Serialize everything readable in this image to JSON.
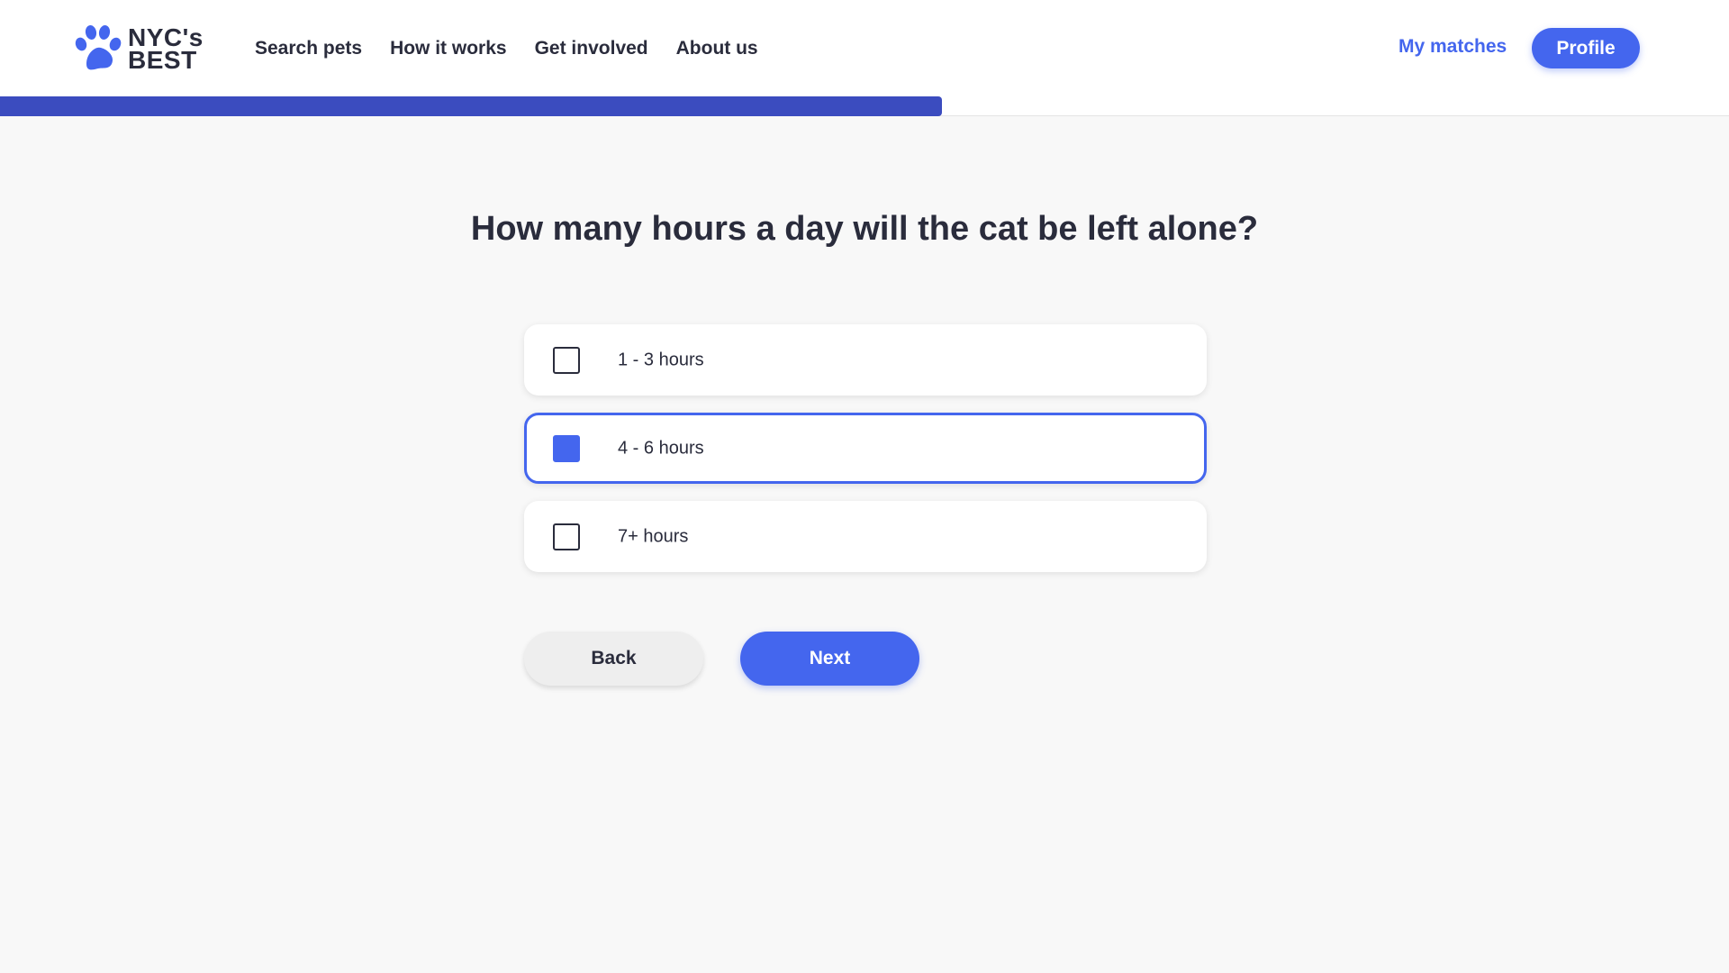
{
  "brand": {
    "line1": "NYC's",
    "line2": "BEST",
    "logo_icon": "paw-icon",
    "accent_color": "#4466ee"
  },
  "nav": {
    "items": [
      {
        "label": "Search pets"
      },
      {
        "label": "How it works"
      },
      {
        "label": "Get involved"
      },
      {
        "label": "About us"
      }
    ],
    "my_matches": "My matches",
    "profile": "Profile"
  },
  "progress": {
    "fraction": 0.545,
    "color": "#3b4cbf"
  },
  "quiz": {
    "question": "How many hours a day will the cat be left alone?",
    "options": [
      {
        "label": "1 - 3 hours",
        "selected": false
      },
      {
        "label": "4 - 6 hours",
        "selected": true
      },
      {
        "label": "7+ hours",
        "selected": false
      }
    ],
    "back_label": "Back",
    "next_label": "Next"
  }
}
